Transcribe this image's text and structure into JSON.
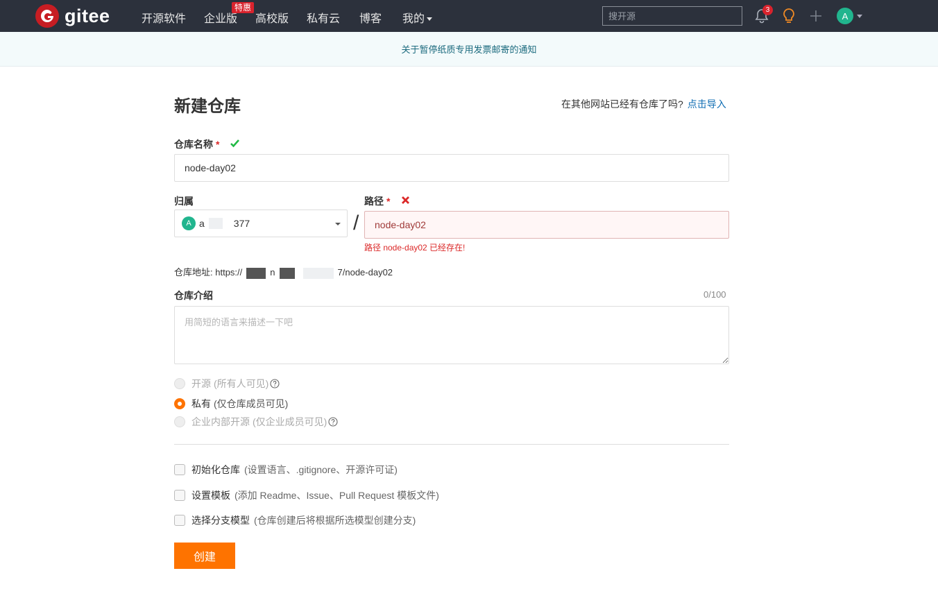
{
  "nav": {
    "logo_text": "gitee",
    "items": [
      "开源软件",
      "企业版",
      "高校版",
      "私有云",
      "博客"
    ],
    "promo_badge": "特惠",
    "mine": "我的",
    "search_placeholder": "搜开源",
    "notification_count": "3",
    "avatar_letter": "A"
  },
  "notice": {
    "text": "关于暂停纸质专用发票邮寄的通知"
  },
  "page": {
    "title": "新建仓库",
    "import_hint": "在其他网站已经有仓库了吗?",
    "import_link": "点击导入"
  },
  "form": {
    "name_label": "仓库名称",
    "required_mark": "*",
    "name_value": "node-day02",
    "owner_label": "归属",
    "owner_avatar": "A",
    "owner_prefix": "a",
    "owner_suffix": "377",
    "slash": "/",
    "path_label": "路径",
    "path_value": "node-day02",
    "path_error": "路径 node-day02 已经存在!",
    "url_label": "仓库地址:",
    "url_start": "https://",
    "url_mid": "n",
    "url_end": "7/node-day02",
    "desc_label": "仓库介绍",
    "desc_count": "0/100",
    "desc_placeholder": "用简短的语言来描述一下吧",
    "visibility": [
      {
        "label": "开源",
        "note": "(所有人可见)",
        "selected": false,
        "disabled": true
      },
      {
        "label": "私有",
        "note": "(仅仓库成员可见)",
        "selected": true,
        "disabled": false
      },
      {
        "label": "企业内部开源",
        "note": "(仅企业成员可见)",
        "selected": false,
        "disabled": true
      }
    ],
    "options": [
      {
        "label": "初始化仓库",
        "note": "(设置语言、.gitignore、开源许可证)"
      },
      {
        "label": "设置模板",
        "note": "(添加 Readme、Issue、Pull Request 模板文件)"
      },
      {
        "label": "选择分支模型",
        "note": "(仓库创建后将根据所选模型创建分支)"
      }
    ],
    "submit": "创建"
  },
  "colors": {
    "nav_bg": "#2c313c",
    "brand": "#c71d23",
    "accent": "#fe7300",
    "error": "#db2828",
    "link": "#0f6db3"
  }
}
